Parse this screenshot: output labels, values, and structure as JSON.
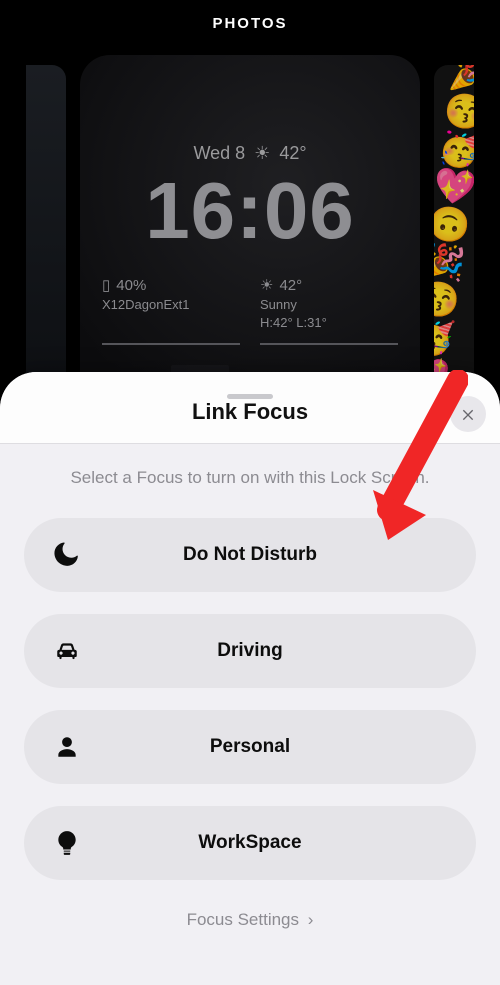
{
  "topbar": {
    "title": "PHOTOS"
  },
  "lockscreen": {
    "date_day": "Wed 8",
    "date_temp": "42°",
    "time": "16:06",
    "battery": {
      "percent": "40%",
      "network": "X12DagonExt1"
    },
    "weather": {
      "temp": "42°",
      "cond": "Sunny",
      "hilo": "H:42° L:31°"
    }
  },
  "sheet": {
    "title": "Link Focus",
    "subtitle": "Select a Focus to turn on with this Lock Screen.",
    "close_aria": "Close",
    "items": [
      {
        "id": "dnd",
        "label": "Do Not Disturb",
        "icon": "moon-icon"
      },
      {
        "id": "driving",
        "label": "Driving",
        "icon": "car-icon"
      },
      {
        "id": "personal",
        "label": "Personal",
        "icon": "person-icon"
      },
      {
        "id": "workspace",
        "label": "WorkSpace",
        "icon": "bulb-icon"
      }
    ],
    "settings_label": "Focus Settings"
  }
}
